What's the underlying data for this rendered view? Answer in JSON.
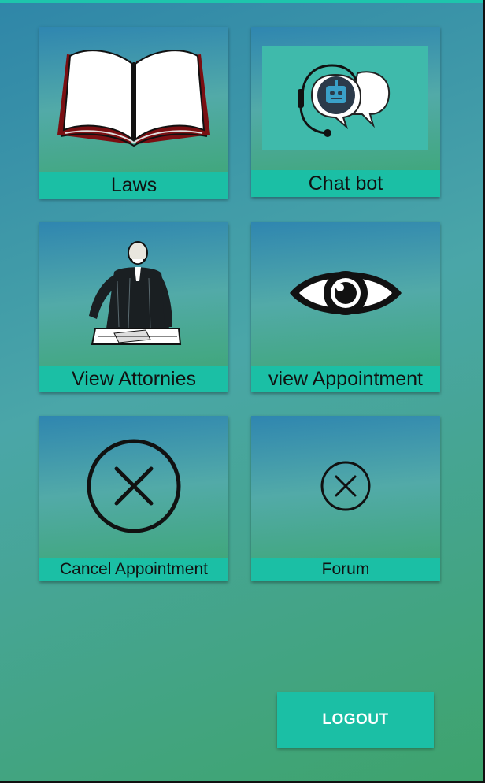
{
  "tiles": {
    "laws": {
      "label": "Laws",
      "icon": "book-icon"
    },
    "chatbot": {
      "label": "Chat bot",
      "icon": "chatbot-icon"
    },
    "attorneys": {
      "label": "View Attornies",
      "icon": "attorney-icon"
    },
    "view_appointment": {
      "label": "view Appointment",
      "icon": "eye-icon"
    },
    "cancel_appointment": {
      "label": "Cancel Appointment",
      "icon": "cancel-icon"
    },
    "forum": {
      "label": "Forum",
      "icon": "cancel-icon"
    }
  },
  "logout": {
    "label": "LOGOUT"
  },
  "colors": {
    "accent": "#1bbfa5",
    "top_bar": "#1ec5ac"
  }
}
